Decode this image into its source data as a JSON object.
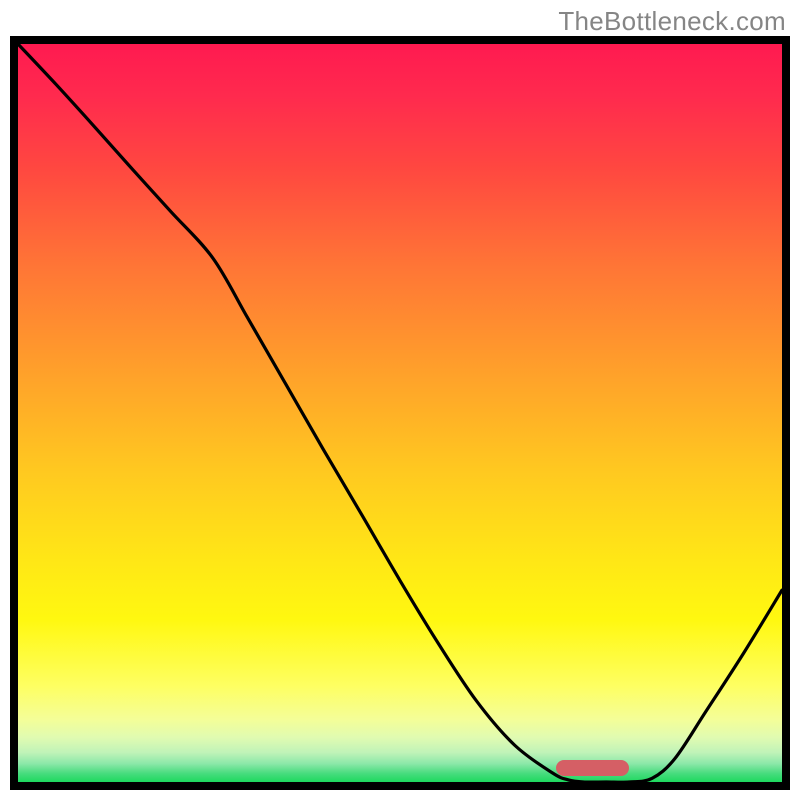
{
  "attribution": "TheBottleneck.com",
  "marker": {
    "x_frac": 0.752,
    "y_frac": 0.981,
    "w_frac": 0.096,
    "h_frac": 0.022,
    "color": "#d55f65"
  },
  "gradient_stops": [
    {
      "pos": 0.0,
      "color": "#ff1a50"
    },
    {
      "pos": 0.07,
      "color": "#ff2a4e"
    },
    {
      "pos": 0.17,
      "color": "#ff4840"
    },
    {
      "pos": 0.3,
      "color": "#ff7536"
    },
    {
      "pos": 0.45,
      "color": "#ffa22a"
    },
    {
      "pos": 0.58,
      "color": "#ffc920"
    },
    {
      "pos": 0.7,
      "color": "#ffe716"
    },
    {
      "pos": 0.78,
      "color": "#fff810"
    },
    {
      "pos": 0.87,
      "color": "#feff62"
    },
    {
      "pos": 0.915,
      "color": "#f4fe98"
    },
    {
      "pos": 0.94,
      "color": "#e0fbb1"
    },
    {
      "pos": 0.96,
      "color": "#c0f3b8"
    },
    {
      "pos": 0.975,
      "color": "#8ce8a9"
    },
    {
      "pos": 0.988,
      "color": "#49dc7f"
    },
    {
      "pos": 1.0,
      "color": "#1ed95e"
    }
  ],
  "chart_data": {
    "type": "line",
    "title": "",
    "xlabel": "",
    "ylabel": "",
    "xlim": [
      0,
      1
    ],
    "ylim": [
      0,
      1
    ],
    "series": [
      {
        "name": "curve",
        "x": [
          0.0,
          0.05,
          0.1,
          0.15,
          0.2,
          0.255,
          0.3,
          0.35,
          0.4,
          0.45,
          0.5,
          0.55,
          0.6,
          0.65,
          0.7,
          0.72,
          0.74,
          0.77,
          0.8,
          0.83,
          0.86,
          0.9,
          0.95,
          1.0
        ],
        "y": [
          1.0,
          0.945,
          0.888,
          0.83,
          0.773,
          0.71,
          0.63,
          0.54,
          0.45,
          0.362,
          0.273,
          0.188,
          0.11,
          0.05,
          0.012,
          0.003,
          0.0,
          0.0,
          0.0,
          0.005,
          0.032,
          0.095,
          0.175,
          0.26
        ]
      }
    ],
    "annotations": [
      {
        "type": "marker-bar",
        "x_center": 0.8,
        "y": 0.01,
        "width": 0.096,
        "color": "#d55f65"
      }
    ]
  }
}
